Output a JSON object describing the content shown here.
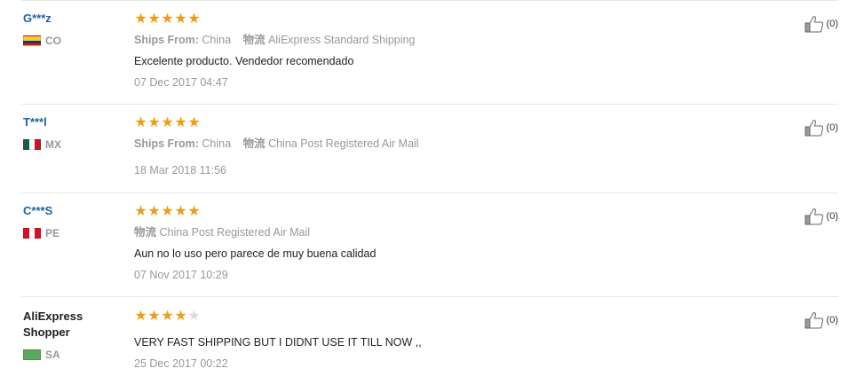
{
  "labels": {
    "ships_from": "Ships From:",
    "logistics": "物流"
  },
  "reviews": [
    {
      "user": "G***z",
      "country": "CO",
      "flag": "colombia",
      "stars": 5,
      "ships_from": "China",
      "shipping": "AliExpress Standard Shipping",
      "text": "Excelente producto. Vendedor recomendado",
      "date": "07 Dec 2017 04:47",
      "helpful": "(0)"
    },
    {
      "user": "T***l",
      "country": "MX",
      "flag": "mexico",
      "stars": 5,
      "ships_from": "China",
      "shipping": "China Post Registered Air Mail",
      "text": "",
      "date": "18 Mar 2018 11:56",
      "helpful": "(0)"
    },
    {
      "user": "C***S",
      "country": "PE",
      "flag": "peru",
      "stars": 5,
      "ships_from": "",
      "shipping": "China Post Registered Air Mail",
      "text": "Aun no lo uso pero parece de muy buena calidad",
      "date": "07 Nov 2017 10:29",
      "helpful": "(0)"
    },
    {
      "user_line1": "AliExpress",
      "user_line2": "Shopper",
      "country": "SA",
      "flag": "saudi",
      "stars": 4,
      "text": "VERY FAST SHIPPING BUT I DIDNT USE IT TILL NOW ,,",
      "date": "25 Dec 2017 00:22",
      "helpful": "(0)"
    }
  ],
  "colors": {
    "star_on": "#f39c12",
    "star_off": "#dcdcdc",
    "username": "#1b62ad",
    "meta": "#999999"
  },
  "icons": [
    "star-icon",
    "thumbs-up-icon",
    "flag-icon"
  ]
}
